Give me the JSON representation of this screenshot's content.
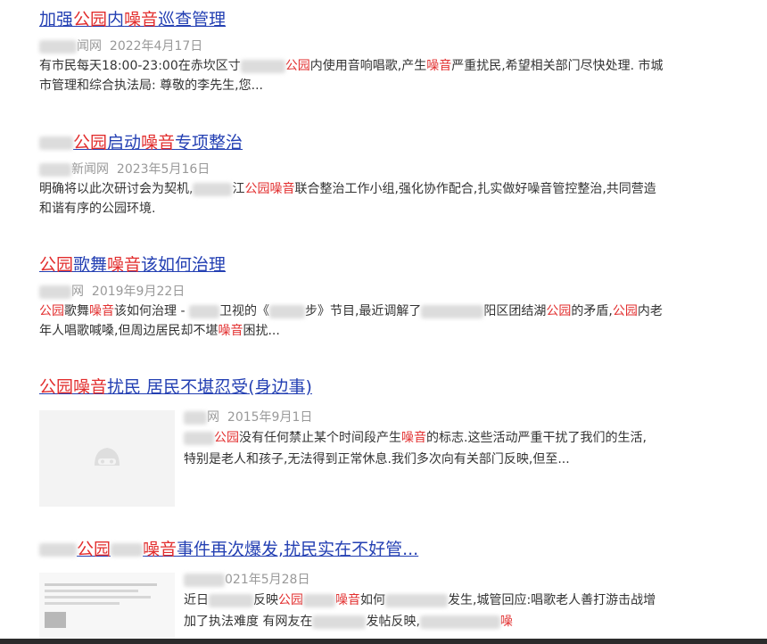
{
  "results": [
    {
      "title_parts": [
        "加强",
        "公园",
        "内",
        "噪音",
        "巡查管理"
      ],
      "source": "闻网",
      "date": "2022年4月17日",
      "snippet_parts": [
        "有市民每天18:00-23:00在赤坎区寸",
        "",
        "公园",
        "内使用音响唱歌,产生",
        "噪音",
        "严重扰民,希望相关部门尽快处理. 市城市管理和综合执法局: 尊敬的李先生,您..."
      ]
    },
    {
      "title_parts": [
        "",
        "公园",
        "启动",
        "噪音",
        "专项整治"
      ],
      "source": "新闻网",
      "date": "2023年5月16日",
      "snippet_parts": [
        "明确将以此次研讨会为契机,",
        "江",
        "公园噪音",
        "联合整治工作小组,强化协作配合,扎实做好噪音管控整治,共同营造和谐有序的公园环境."
      ]
    },
    {
      "title_parts": [
        "公园",
        "歌舞",
        "噪音",
        "该如何治理"
      ],
      "source": "网",
      "date": "2019年9月22日",
      "snippet_parts": [
        "公园",
        "歌舞",
        "噪音",
        "该如何治理 - ",
        "卫视的《",
        "步》节目,最近调解了",
        "阳区团结湖",
        "公园",
        "的矛盾,",
        "公园",
        "内老年人唱歌喊嗓,但周边居民却不堪",
        "噪音",
        "困扰..."
      ]
    },
    {
      "title_parts": [
        "公园",
        "噪音",
        "扰民 居民不堪忍受(身边事)"
      ],
      "source": "网",
      "date": "2015年9月1日",
      "snippet_parts": [
        "公园",
        "没有任何禁止某个时间段产生",
        "噪音",
        "的标志.这些活动严重干扰了我们的生活,特别是老人和孩子,无法得到正常休息.我们多次向有关部门反映,但至..."
      ]
    },
    {
      "title_parts": [
        "公园",
        "噪音",
        "事件再次爆发,扰民实在不好管..."
      ],
      "source": "",
      "date": "021年5月28日",
      "snippet_parts": [
        "近日",
        "反映",
        "公园",
        "噪音",
        "如何",
        "发生,城管回应:唱歌老人善打游击战增加了执法难度 有网友在",
        "发帖反映,",
        "噪"
      ]
    }
  ],
  "colors": {
    "link": "#2440b3",
    "highlight": "#e22e2e",
    "meta": "#999999"
  },
  "icons": {
    "thumb_placeholder": "image-placeholder-icon"
  }
}
